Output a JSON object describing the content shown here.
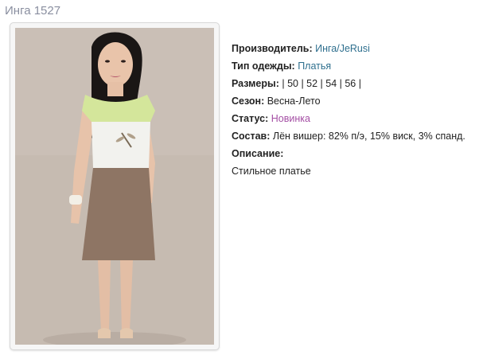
{
  "product": {
    "title": "Инга 1527"
  },
  "image": {
    "alt": ""
  },
  "details": {
    "manufacturer_label": "Производитель:",
    "manufacturer_value": "Инга/JeRusi",
    "type_label": "Тип одежды:",
    "type_value": "Платья",
    "sizes_label": "Размеры:",
    "sizes_value": "| 50 | 52 | 54 | 56 |",
    "season_label": "Сезон:",
    "season_value": "Весна-Лето",
    "status_label": "Статус:",
    "status_value": "Новинка",
    "composition_label": "Состав:",
    "composition_value": "Лён вишер: 82% п/э, 15% виск, 3% спанд.",
    "description_label": "Описание:",
    "description_value": "Стильное платье"
  },
  "colors": {
    "title": "#8a8fa0",
    "link": "#2e6f8e",
    "status": "#a44fa4"
  }
}
